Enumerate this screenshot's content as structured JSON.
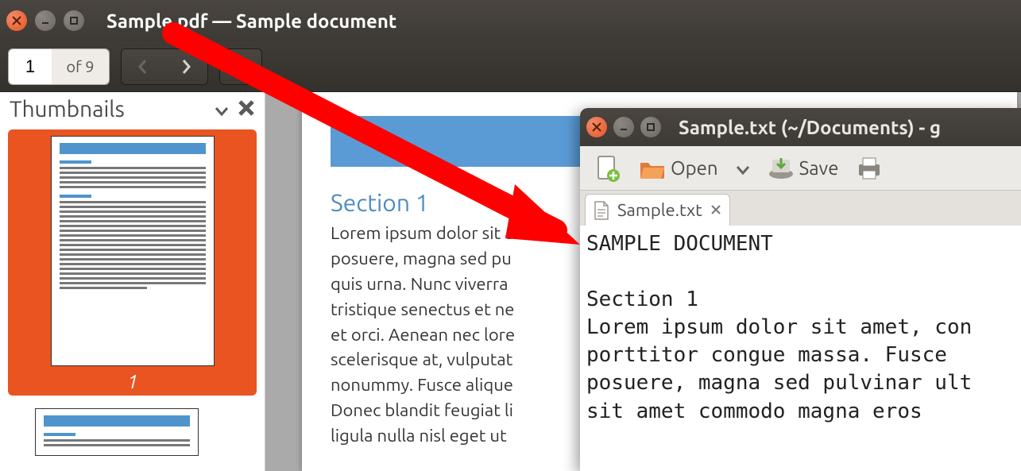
{
  "pdf_viewer": {
    "title": "Sample.pdf — Sample document",
    "page_current": "1",
    "page_total_label": "of 9",
    "sidebar": {
      "title": "Thumbnails",
      "selected_page_number": "1"
    },
    "document": {
      "section_title": "Section 1",
      "body_text": "Lorem ipsum dolor sit a\nposuere, magna sed pu\nquis urna. Nunc viverra\ntristique senectus et ne\net orci. Aenean nec lore\nscelerisque at, vulputat\nnonummy. Fusce alique\nDonec blandit feugiat li\nligula nulla nisl eget ut"
    }
  },
  "gedit": {
    "title": "Sample.txt (~/Documents) - g",
    "toolbar": {
      "open_label": "Open",
      "save_label": "Save"
    },
    "tab": {
      "filename": "Sample.txt"
    },
    "content": "SAMPLE DOCUMENT\n\nSection 1\nLorem ipsum dolor sit amet, con\nporttitor congue massa. Fusce\nposuere, magna sed pulvinar ult\nsit amet commodo magna eros"
  }
}
